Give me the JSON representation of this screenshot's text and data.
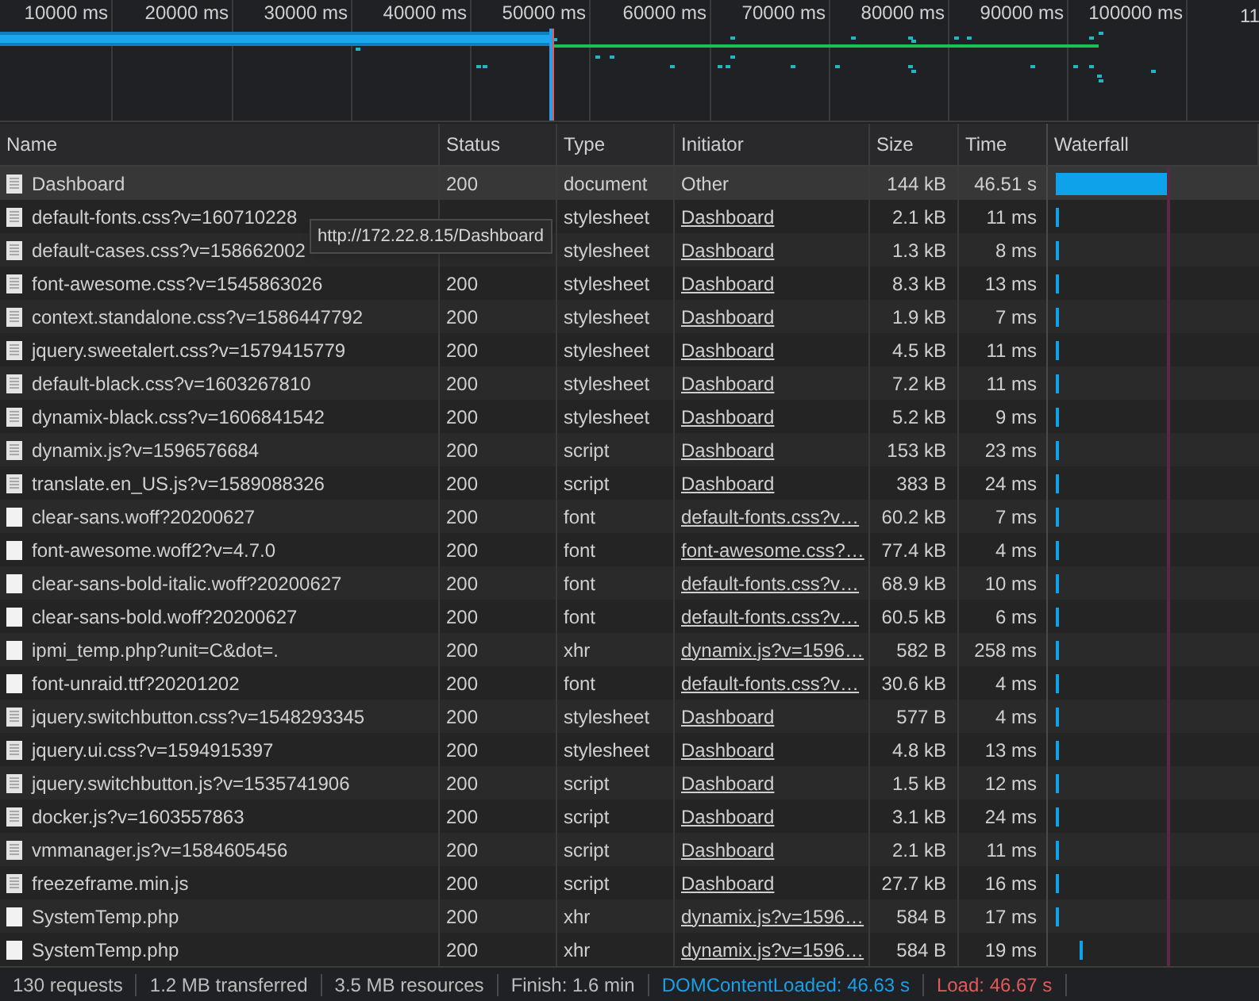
{
  "overview": {
    "ticks": [
      "10000 ms",
      "20000 ms",
      "30000 ms",
      "40000 ms",
      "50000 ms",
      "60000 ms",
      "70000 ms",
      "80000 ms",
      "90000 ms",
      "100000 ms",
      "11"
    ]
  },
  "table": {
    "columns": [
      "Name",
      "Status",
      "Type",
      "Initiator",
      "Size",
      "Time",
      "Waterfall"
    ],
    "rows": [
      {
        "kind": "lined",
        "name": "Dashboard",
        "status": "200",
        "type": "document",
        "initiator": "Other",
        "link": false,
        "size": "144 kB",
        "time": "46.51 s",
        "hovered": true
      },
      {
        "kind": "lined",
        "name": "default-fonts.css?v=160710228",
        "type": "stylesheet",
        "initiator": "Dashboard",
        "link": true,
        "size": "2.1 kB",
        "time": "11 ms",
        "hovered": false
      },
      {
        "kind": "lined",
        "name": "default-cases.css?v=158662002",
        "type": "stylesheet",
        "initiator": "Dashboard",
        "link": true,
        "size": "1.3 kB",
        "time": "8 ms",
        "hovered": false
      },
      {
        "kind": "lined",
        "name": "font-awesome.css?v=1545863026",
        "status": "200",
        "type": "stylesheet",
        "initiator": "Dashboard",
        "link": true,
        "size": "8.3 kB",
        "time": "13 ms",
        "hovered": false
      },
      {
        "kind": "lined",
        "name": "context.standalone.css?v=1586447792",
        "status": "200",
        "type": "stylesheet",
        "initiator": "Dashboard",
        "link": true,
        "size": "1.9 kB",
        "time": "7 ms",
        "hovered": false
      },
      {
        "kind": "lined",
        "name": "jquery.sweetalert.css?v=1579415779",
        "status": "200",
        "type": "stylesheet",
        "initiator": "Dashboard",
        "link": true,
        "size": "4.5 kB",
        "time": "11 ms",
        "hovered": false
      },
      {
        "kind": "lined",
        "name": "default-black.css?v=1603267810",
        "status": "200",
        "type": "stylesheet",
        "initiator": "Dashboard",
        "link": true,
        "size": "7.2 kB",
        "time": "11 ms",
        "hovered": false
      },
      {
        "kind": "lined",
        "name": "dynamix-black.css?v=1606841542",
        "status": "200",
        "type": "stylesheet",
        "initiator": "Dashboard",
        "link": true,
        "size": "5.2 kB",
        "time": "9 ms",
        "hovered": false
      },
      {
        "kind": "lined",
        "name": "dynamix.js?v=1596576684",
        "status": "200",
        "type": "script",
        "initiator": "Dashboard",
        "link": true,
        "size": "153 kB",
        "time": "23 ms",
        "hovered": false
      },
      {
        "kind": "lined",
        "name": "translate.en_US.js?v=1589088326",
        "status": "200",
        "type": "script",
        "initiator": "Dashboard",
        "link": true,
        "size": "383 B",
        "time": "24 ms",
        "hovered": false
      },
      {
        "kind": "plain",
        "name": "clear-sans.woff?20200627",
        "status": "200",
        "type": "font",
        "initiator": "default-fonts.css?v…",
        "link": true,
        "size": "60.2 kB",
        "time": "7 ms",
        "hovered": false
      },
      {
        "kind": "plain",
        "name": "font-awesome.woff2?v=4.7.0",
        "status": "200",
        "type": "font",
        "initiator": "font-awesome.css?…",
        "link": true,
        "size": "77.4 kB",
        "time": "4 ms",
        "hovered": false
      },
      {
        "kind": "plain",
        "name": "clear-sans-bold-italic.woff?20200627",
        "status": "200",
        "type": "font",
        "initiator": "default-fonts.css?v…",
        "link": true,
        "size": "68.9 kB",
        "time": "10 ms",
        "hovered": false
      },
      {
        "kind": "plain",
        "name": "clear-sans-bold.woff?20200627",
        "status": "200",
        "type": "font",
        "initiator": "default-fonts.css?v…",
        "link": true,
        "size": "60.5 kB",
        "time": "6 ms",
        "hovered": false
      },
      {
        "kind": "plain",
        "name": "ipmi_temp.php?unit=C&dot=.",
        "status": "200",
        "type": "xhr",
        "initiator": "dynamix.js?v=1596…",
        "link": true,
        "size": "582 B",
        "time": "258 ms",
        "hovered": false
      },
      {
        "kind": "plain",
        "name": "font-unraid.ttf?20201202",
        "status": "200",
        "type": "font",
        "initiator": "default-fonts.css?v…",
        "link": true,
        "size": "30.6 kB",
        "time": "4 ms",
        "hovered": false
      },
      {
        "kind": "lined",
        "name": "jquery.switchbutton.css?v=1548293345",
        "status": "200",
        "type": "stylesheet",
        "initiator": "Dashboard",
        "link": true,
        "size": "577 B",
        "time": "4 ms",
        "hovered": false
      },
      {
        "kind": "lined",
        "name": "jquery.ui.css?v=1594915397",
        "status": "200",
        "type": "stylesheet",
        "initiator": "Dashboard",
        "link": true,
        "size": "4.8 kB",
        "time": "13 ms",
        "hovered": false
      },
      {
        "kind": "lined",
        "name": "jquery.switchbutton.js?v=1535741906",
        "status": "200",
        "type": "script",
        "initiator": "Dashboard",
        "link": true,
        "size": "1.5 kB",
        "time": "12 ms",
        "hovered": false
      },
      {
        "kind": "lined",
        "name": "docker.js?v=1603557863",
        "status": "200",
        "type": "script",
        "initiator": "Dashboard",
        "link": true,
        "size": "3.1 kB",
        "time": "24 ms",
        "hovered": false
      },
      {
        "kind": "lined",
        "name": "vmmanager.js?v=1584605456",
        "status": "200",
        "type": "script",
        "initiator": "Dashboard",
        "link": true,
        "size": "2.1 kB",
        "time": "11 ms",
        "hovered": false
      },
      {
        "kind": "lined",
        "name": "freezeframe.min.js",
        "status": "200",
        "type": "script",
        "initiator": "Dashboard",
        "link": true,
        "size": "27.7 kB",
        "time": "16 ms",
        "hovered": false
      },
      {
        "kind": "plain",
        "name": "SystemTemp.php",
        "status": "200",
        "type": "xhr",
        "initiator": "dynamix.js?v=1596…",
        "link": true,
        "size": "584 B",
        "time": "17 ms",
        "hovered": false
      },
      {
        "kind": "plain",
        "name": "SystemTemp.php",
        "status": "200",
        "type": "xhr",
        "initiator": "dynamix.js?v=1596…",
        "link": true,
        "size": "584 B",
        "time": "19 ms",
        "hovered": false
      }
    ]
  },
  "tooltip": {
    "text": "http://172.22.8.15/Dashboard"
  },
  "status_bar": [
    {
      "text": "130 requests",
      "color": "#bdbdbd"
    },
    {
      "text": "1.2 MB transferred",
      "color": "#bdbdbd"
    },
    {
      "text": "3.5 MB resources",
      "color": "#bdbdbd"
    },
    {
      "text": "Finish: 1.6 min",
      "color": "#bdbdbd"
    },
    {
      "text": "DOMContentLoaded: 46.63 s",
      "color": "#1a9fe8"
    },
    {
      "text": "Load: 46.67 s",
      "color": "#e35a5a"
    }
  ]
}
